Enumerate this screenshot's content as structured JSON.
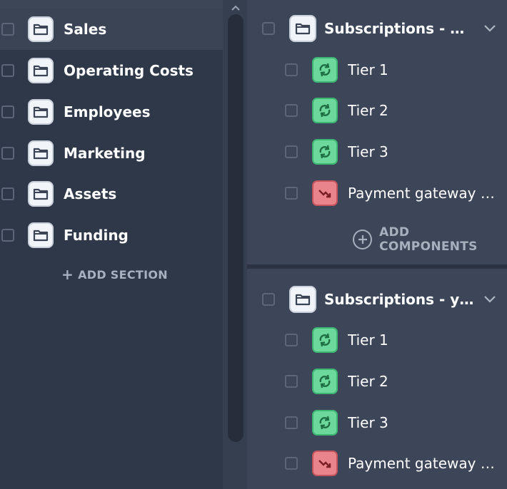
{
  "sections": {
    "items": [
      {
        "label": "Sales",
        "icon": "folder-icon"
      },
      {
        "label": "Operating Costs",
        "icon": "folder-icon"
      },
      {
        "label": "Employees",
        "icon": "folder-icon"
      },
      {
        "label": "Marketing",
        "icon": "folder-icon"
      },
      {
        "label": "Assets",
        "icon": "folder-icon"
      },
      {
        "label": "Funding",
        "icon": "folder-icon"
      }
    ],
    "add_label": "ADD SECTION"
  },
  "groups": [
    {
      "title": "Subscriptions - monthly",
      "components": [
        {
          "label": "Tier 1",
          "type": "revenue",
          "icon": "recurring-icon"
        },
        {
          "label": "Tier 2",
          "type": "revenue",
          "icon": "recurring-icon"
        },
        {
          "label": "Tier 3",
          "type": "revenue",
          "icon": "recurring-icon"
        },
        {
          "label": "Payment gateway costs",
          "type": "cost",
          "icon": "trend-down-icon"
        }
      ],
      "add_label": "ADD COMPONENTS"
    },
    {
      "title": "Subscriptions - yearly",
      "components": [
        {
          "label": "Tier 1",
          "type": "revenue",
          "icon": "recurring-icon"
        },
        {
          "label": "Tier 2",
          "type": "revenue",
          "icon": "recurring-icon"
        },
        {
          "label": "Tier 3",
          "type": "revenue",
          "icon": "recurring-icon"
        },
        {
          "label": "Payment gateway costs",
          "type": "cost",
          "icon": "trend-down-icon"
        }
      ]
    }
  ],
  "colors": {
    "revenue": "#6dd89b",
    "cost": "#e9848a",
    "panel_bg": "#2f3848",
    "group_bg": "#3d4658"
  }
}
